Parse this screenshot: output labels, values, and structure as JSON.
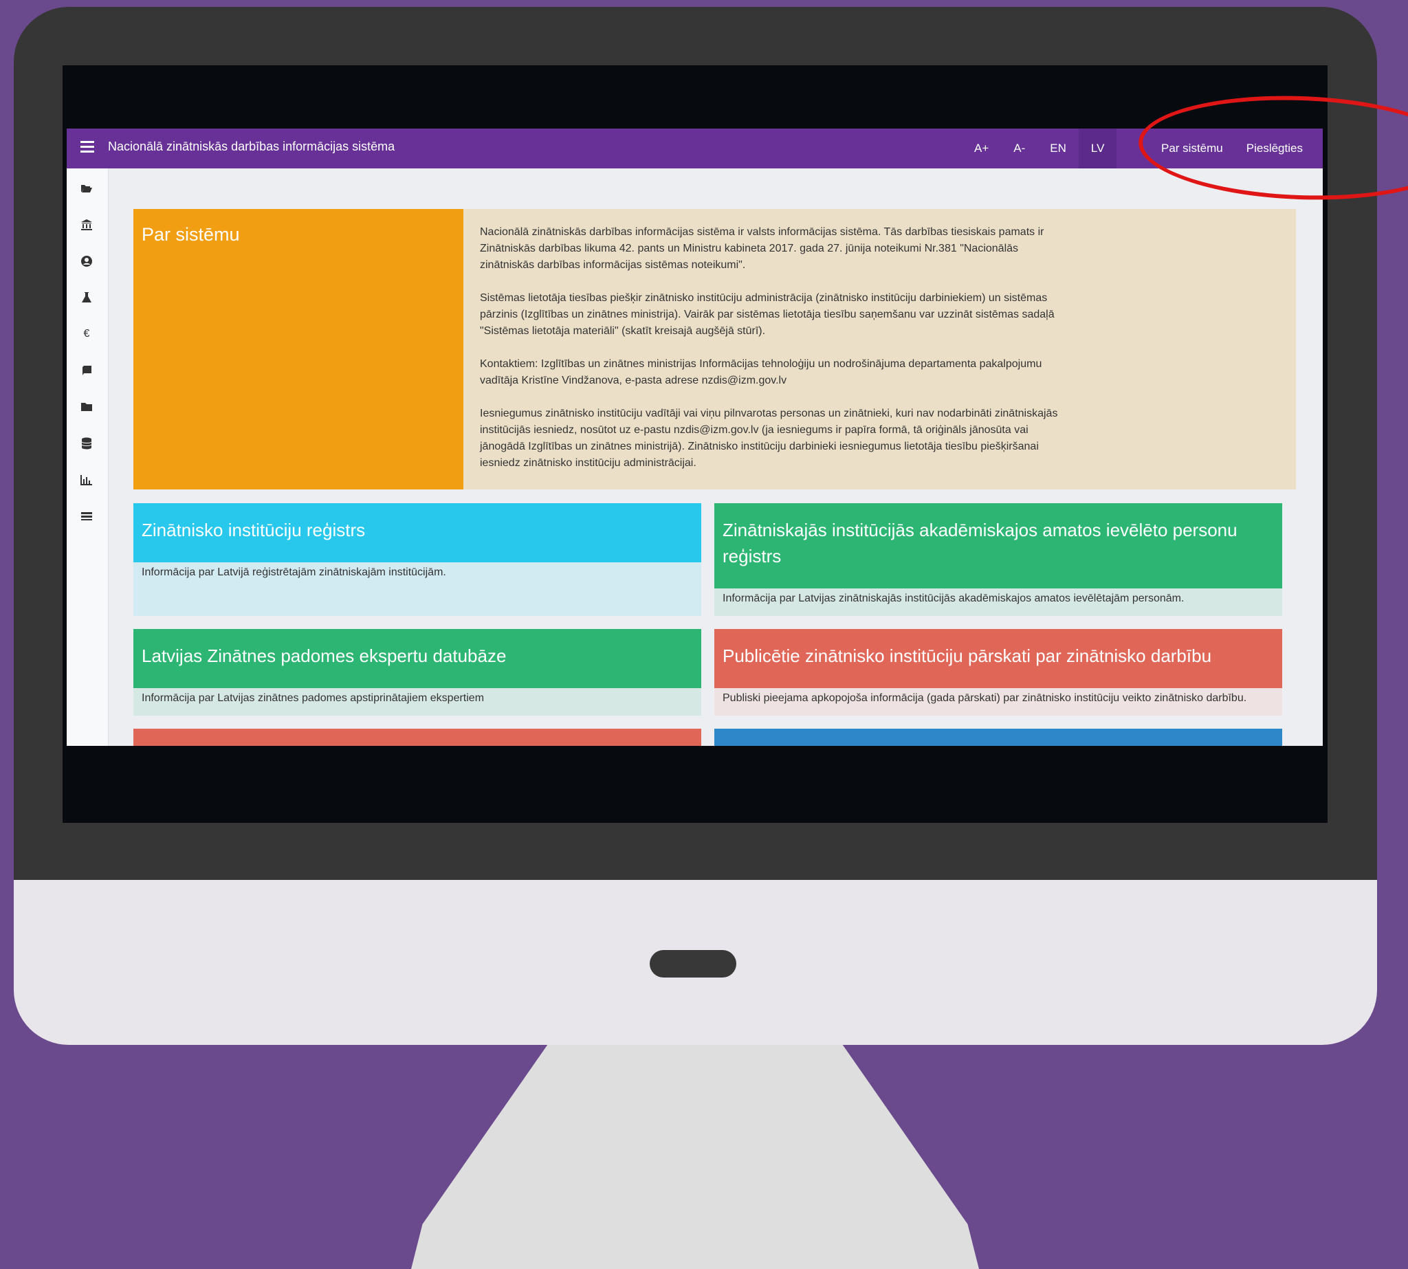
{
  "app": {
    "title": "Nacionālā zinātniskās darbības informācijas sistēma"
  },
  "topbar": {
    "font_increase": "A+",
    "font_decrease": "A-",
    "lang_en": "EN",
    "lang_lv": "LV",
    "about_link": "Par sistēmu",
    "login_link": "Pieslēgties"
  },
  "sidebar": {
    "icons": [
      "folder-open-icon",
      "institution-icon",
      "user-circle-icon",
      "flask-icon",
      "euro-icon",
      "book-icon",
      "folder-icon",
      "database-icon",
      "bar-chart-icon",
      "list-icon"
    ]
  },
  "about": {
    "title": "Par sistēmu",
    "paragraphs": [
      "Nacionālā zinātniskās darbības informācijas sistēma ir valsts informācijas sistēma. Tās darbības tiesiskais pamats ir Zinātniskās darbības likuma 42. pants un Ministru kabineta 2017. gada 27. jūnija noteikumi Nr.381 \"Nacionālās zinātniskās darbības informācijas sistēmas noteikumi\".",
      "Sistēmas lietotāja tiesības piešķir zinātnisko institūciju administrācija (zinātnisko institūciju darbiniekiem) un sistēmas pārzinis (Izglītības un zinātnes ministrija). Vairāk par sistēmas lietotāja tiesību saņemšanu var uzzināt sistēmas sadaļā \"Sistēmas lietotāja materiāli\" (skatīt kreisajā augšējā stūrī).",
      "Kontaktiem: Izglītības un zinātnes ministrijas Informācijas tehnoloģiju un nodrošinājuma departamenta pakalpojumu vadītāja Kristīne Vindžanova, e-pasta adrese nzdis@izm.gov.lv",
      "Iesniegumus zinātnisko institūciju vadītāji vai viņu pilnvarotas personas un zinātnieki, kuri nav nodarbināti zinātniskajās institūcijās iesniedz, nosūtot uz e-pastu nzdis@izm.gov.lv (ja iesniegums ir papīra formā, tā oriģināls jānosūta vai jānogādā Izglītības un zinātnes ministrijā). Zinātnisko institūciju darbinieki iesniegumus lietotāja tiesību piešķiršanai iesniedz zinātnisko institūciju administrācijai."
    ]
  },
  "cards": [
    {
      "title": "Zinātnisko institūciju reģistrs",
      "desc": "Informācija par Latvijā reģistrētajām zinātniskajām institūcijām.",
      "color": "#28c8ec"
    },
    {
      "title": "Zinātniskajās institūcijās akadēmiskajos amatos ievēlēto personu reģistrs",
      "desc": "Informācija par Latvijas zinātniskajās institūcijās akadēmiskajos amatos ievēlētajām personām.",
      "color": "#2cb573"
    },
    {
      "title": "Latvijas Zinātnes padomes ekspertu datubāze",
      "desc": "Informācija par Latvijas zinātnes padomes apstiprinātajiem ekspertiem",
      "color": "#2cb573"
    },
    {
      "title": "Publicētie zinātnisko institūciju pārskati par zinātnisko darbību",
      "desc": "Publiski pieejama apkopojoša informācija (gada pārskati) par zinātnisko institūciju veikto zinātnisko darbību.",
      "color": "#e06758"
    },
    {
      "color": "#e06758"
    },
    {
      "color": "#2e87c9"
    }
  ],
  "annotation": {
    "color": "#e01616",
    "target": "topbar-right-links"
  }
}
